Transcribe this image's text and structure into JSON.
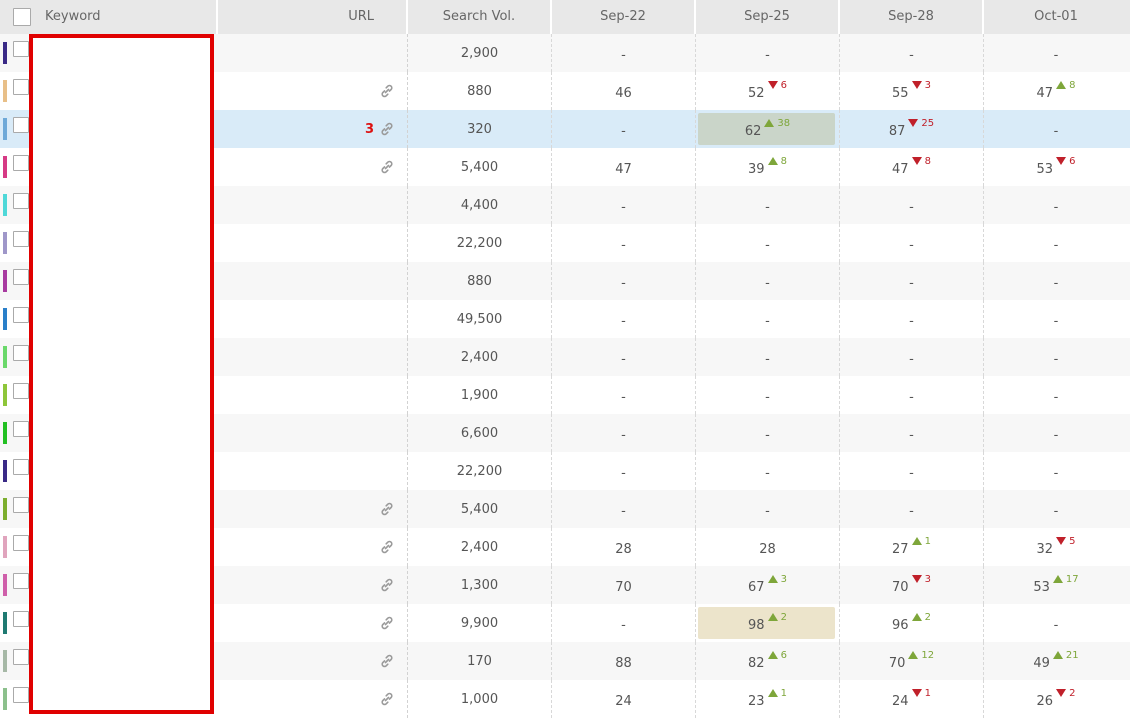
{
  "header": {
    "keyword": "Keyword",
    "url": "URL",
    "volume": "Search Vol.",
    "dates": [
      "Sep-22",
      "Sep-25",
      "Sep-28",
      "Oct-01"
    ]
  },
  "colors": {
    "up": "#7ea63a",
    "down": "#c0202a",
    "url_count": "#dd1111",
    "selected_row": "#d9ebf8",
    "redaction_border": "#e00000"
  },
  "rows": [
    {
      "bar": "#3a2a86",
      "link": false,
      "url_count": "",
      "volume": "2,900",
      "d": [
        {
          "v": "-"
        },
        {
          "v": "-"
        },
        {
          "v": "-"
        },
        {
          "v": "-"
        }
      ]
    },
    {
      "bar": "#e8bf88",
      "link": true,
      "url_count": "",
      "volume": "880",
      "d": [
        {
          "v": "46"
        },
        {
          "v": "52",
          "dir": "down",
          "c": "6"
        },
        {
          "v": "55",
          "dir": "down",
          "c": "3"
        },
        {
          "v": "47",
          "dir": "up",
          "c": "8"
        }
      ]
    },
    {
      "bar": "#6ea9d8",
      "link": true,
      "url_count": "3",
      "volume": "320",
      "selected": true,
      "d": [
        {
          "v": "-"
        },
        {
          "v": "62",
          "dir": "up",
          "c": "38",
          "hl": "green"
        },
        {
          "v": "87",
          "dir": "down",
          "c": "25"
        },
        {
          "v": "-"
        }
      ]
    },
    {
      "bar": "#d63a85",
      "link": true,
      "url_count": "",
      "volume": "5,400",
      "d": [
        {
          "v": "47"
        },
        {
          "v": "39",
          "dir": "up",
          "c": "8"
        },
        {
          "v": "47",
          "dir": "down",
          "c": "8"
        },
        {
          "v": "53",
          "dir": "down",
          "c": "6"
        }
      ]
    },
    {
      "bar": "#4fd8d8",
      "link": false,
      "url_count": "",
      "volume": "4,400",
      "d": [
        {
          "v": "-"
        },
        {
          "v": "-"
        },
        {
          "v": "-"
        },
        {
          "v": "-"
        }
      ]
    },
    {
      "bar": "#9f97c9",
      "link": false,
      "url_count": "",
      "volume": "22,200",
      "d": [
        {
          "v": "-"
        },
        {
          "v": "-"
        },
        {
          "v": "-"
        },
        {
          "v": "-"
        }
      ]
    },
    {
      "bar": "#a83aa0",
      "link": false,
      "url_count": "",
      "volume": "880",
      "d": [
        {
          "v": "-"
        },
        {
          "v": "-"
        },
        {
          "v": "-"
        },
        {
          "v": "-"
        }
      ]
    },
    {
      "bar": "#2a7fc9",
      "link": false,
      "url_count": "",
      "volume": "49,500",
      "d": [
        {
          "v": "-"
        },
        {
          "v": "-"
        },
        {
          "v": "-"
        },
        {
          "v": "-"
        }
      ]
    },
    {
      "bar": "#6ad86a",
      "link": false,
      "url_count": "",
      "volume": "2,400",
      "d": [
        {
          "v": "-"
        },
        {
          "v": "-"
        },
        {
          "v": "-"
        },
        {
          "v": "-"
        }
      ]
    },
    {
      "bar": "#8ec63a",
      "link": false,
      "url_count": "",
      "volume": "1,900",
      "d": [
        {
          "v": "-"
        },
        {
          "v": "-"
        },
        {
          "v": "-"
        },
        {
          "v": "-"
        }
      ]
    },
    {
      "bar": "#22c022",
      "link": false,
      "url_count": "",
      "volume": "6,600",
      "d": [
        {
          "v": "-"
        },
        {
          "v": "-"
        },
        {
          "v": "-"
        },
        {
          "v": "-"
        }
      ]
    },
    {
      "bar": "#3a2a86",
      "link": false,
      "url_count": "",
      "volume": "22,200",
      "d": [
        {
          "v": "-"
        },
        {
          "v": "-"
        },
        {
          "v": "-"
        },
        {
          "v": "-"
        }
      ]
    },
    {
      "bar": "#7cae2e",
      "link": true,
      "url_count": "",
      "volume": "5,400",
      "d": [
        {
          "v": "-"
        },
        {
          "v": "-"
        },
        {
          "v": "-"
        },
        {
          "v": "-"
        }
      ]
    },
    {
      "bar": "#e0a4bd",
      "link": true,
      "url_count": "",
      "volume": "2,400",
      "d": [
        {
          "v": "28"
        },
        {
          "v": "28"
        },
        {
          "v": "27",
          "dir": "up",
          "c": "1"
        },
        {
          "v": "32",
          "dir": "down",
          "c": "5"
        }
      ]
    },
    {
      "bar": "#cf5faa",
      "link": true,
      "url_count": "",
      "volume": "1,300",
      "d": [
        {
          "v": "70"
        },
        {
          "v": "67",
          "dir": "up",
          "c": "3"
        },
        {
          "v": "70",
          "dir": "down",
          "c": "3"
        },
        {
          "v": "53",
          "dir": "up",
          "c": "17"
        }
      ]
    },
    {
      "bar": "#1f7a72",
      "link": true,
      "url_count": "",
      "volume": "9,900",
      "d": [
        {
          "v": "-"
        },
        {
          "v": "98",
          "dir": "up",
          "c": "2",
          "hl": "tan"
        },
        {
          "v": "96",
          "dir": "up",
          "c": "2"
        },
        {
          "v": "-"
        }
      ]
    },
    {
      "bar": "#a6b8a6",
      "link": true,
      "url_count": "",
      "volume": "170",
      "d": [
        {
          "v": "88"
        },
        {
          "v": "82",
          "dir": "up",
          "c": "6"
        },
        {
          "v": "70",
          "dir": "up",
          "c": "12"
        },
        {
          "v": "49",
          "dir": "up",
          "c": "21"
        }
      ]
    },
    {
      "bar": "#8cc08c",
      "link": true,
      "url_count": "",
      "volume": "1,000",
      "d": [
        {
          "v": "24"
        },
        {
          "v": "23",
          "dir": "up",
          "c": "1"
        },
        {
          "v": "24",
          "dir": "down",
          "c": "1"
        },
        {
          "v": "26",
          "dir": "down",
          "c": "2"
        }
      ]
    }
  ]
}
